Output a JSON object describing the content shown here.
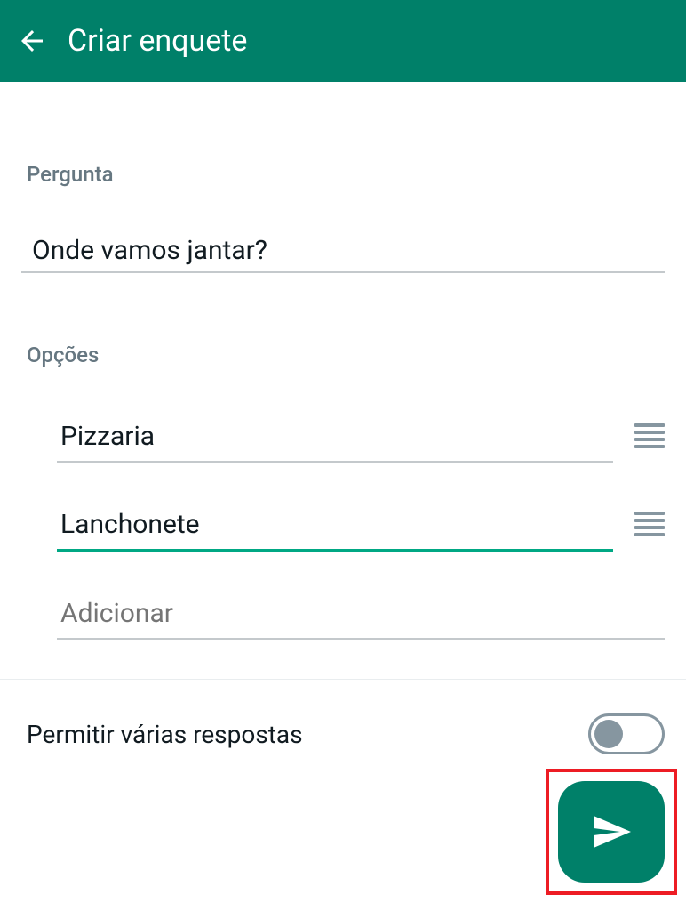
{
  "header": {
    "title": "Criar enquete"
  },
  "question": {
    "label": "Pergunta",
    "value": "Onde vamos jantar?"
  },
  "options": {
    "label": "Opções",
    "items": [
      {
        "value": "Pizzaria"
      },
      {
        "value": "Lanchonete"
      }
    ],
    "add_placeholder": "Adicionar"
  },
  "settings": {
    "multiple_answers_label": "Permitir várias respostas",
    "multiple_answers_enabled": false
  }
}
